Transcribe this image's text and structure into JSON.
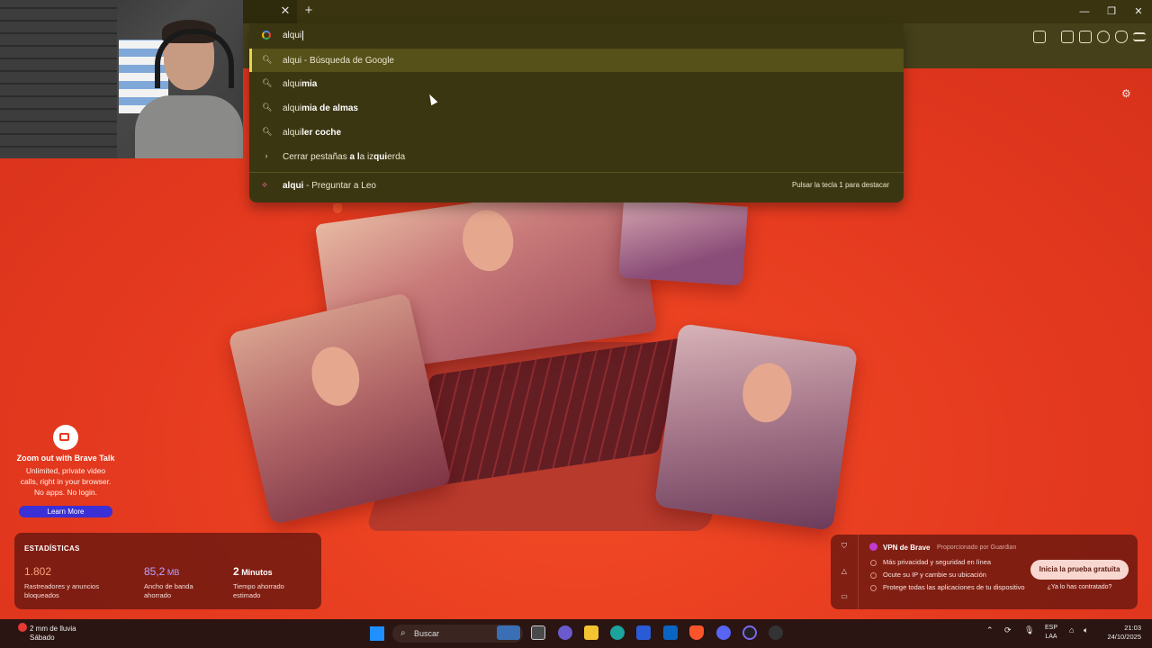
{
  "omnibox": {
    "query": "alqui",
    "suggestions": [
      {
        "typed": "alqui",
        "completion": "",
        "suffix": " - Búsqueda de Google",
        "icon": "search-icon",
        "selected": true
      },
      {
        "typed": "alqui",
        "completion": "mia",
        "suffix": "",
        "icon": "search-icon",
        "selected": false
      },
      {
        "typed": "alqui",
        "completion": "mia de almas",
        "suffix": "",
        "icon": "search-icon",
        "selected": false
      },
      {
        "typed": "alqui",
        "completion": "ler coche",
        "suffix": "",
        "icon": "search-icon",
        "selected": false
      }
    ],
    "tab_action": {
      "pre": "Cerrar pestañas ",
      "b1": "a l",
      "mid": "a iz",
      "b2": "qui",
      "post": "erda",
      "icon": "chevron-right-icon"
    },
    "leo": {
      "query": "alqui",
      "suffix": " - Preguntar a Leo",
      "hint": "Pulsar la tecla 1 para destacar",
      "icon": "leo-icon"
    }
  },
  "brave_talk": {
    "title": "Zoom out with Brave Talk",
    "line1": "Unlimited, private video",
    "line2": "calls, right in your browser.",
    "line3": "No apps. No login.",
    "button": "Learn More"
  },
  "stats": {
    "title": "ESTADÍSTICAS",
    "items": [
      {
        "value": "1.802",
        "unit": "",
        "label1": "Rastreadores y anuncios",
        "label2": "bloqueados",
        "color": "#f6a27a"
      },
      {
        "value": "85,2",
        "unit": " MB",
        "label1": "Ancho de banda",
        "label2": "ahorrado",
        "color": "#b9a3ff"
      },
      {
        "value": "2",
        "unit": " Minutos",
        "label1": "Tiempo ahorrado",
        "label2": "estimado",
        "color": "#ffffff"
      }
    ]
  },
  "vpn": {
    "title": "VPN de Brave",
    "powered": "Proporcionado por  Guardian",
    "items": [
      "Más privacidad y seguridad en línea",
      "Ocute su IP y cambie su ubicación",
      "Protege todas las aplicaciones de tu dispositivo"
    ],
    "cta": "Inicia la prueba gratuita",
    "link": "¿Ya lo has contratado?"
  },
  "taskbar": {
    "weather_line1": "2 mm de lluvia",
    "weather_line2": "Sábado",
    "search_label": "Buscar",
    "lang_line1": "ESP",
    "lang_line2": "LAA",
    "time": "21:03",
    "date": "24/10/2025"
  },
  "colors": {
    "accent": "#e8381f",
    "omnibox_bg": "#3b3612",
    "selected_row": "#565019"
  }
}
